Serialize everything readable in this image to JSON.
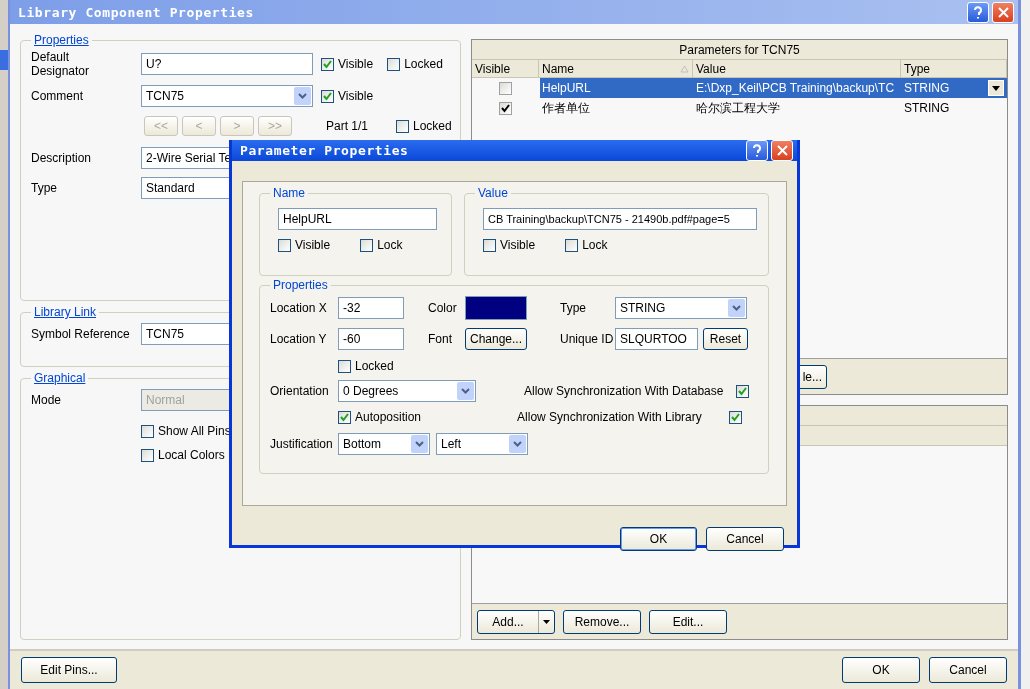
{
  "window": {
    "title": "Library Component Properties"
  },
  "properties": {
    "legend": "Properties",
    "designator": {
      "label": "Default Designator",
      "value": "U?",
      "visible": {
        "label": "Visible",
        "checked": true
      },
      "locked": {
        "label": "Locked",
        "checked": false
      }
    },
    "comment": {
      "label": "Comment",
      "value": "TCN75",
      "visible": {
        "label": "Visible",
        "checked": true
      }
    },
    "part_nav": {
      "buttons": [
        "<<",
        "<",
        ">",
        ">>"
      ],
      "disabled": true,
      "part": "Part 1/1",
      "locked": {
        "label": "Locked",
        "checked": false
      }
    },
    "description": {
      "label": "Description",
      "value": "2-Wire Serial Te"
    },
    "type": {
      "label": "Type",
      "value": "Standard"
    }
  },
  "library_link": {
    "legend": "Library Link",
    "symbol_reference": {
      "label": "Symbol Reference",
      "value": "TCN75"
    }
  },
  "graphical": {
    "legend": "Graphical",
    "mode": {
      "label": "Mode",
      "value": "Normal",
      "disabled": true
    },
    "show_all_pins": {
      "label": "Show All Pins",
      "checked": false
    },
    "local_colors": {
      "label": "Local Colors",
      "checked": false
    }
  },
  "parameters": {
    "title": "Parameters for TCN75",
    "columns": [
      "Visible",
      "Name",
      "Value",
      "Type"
    ],
    "rows": [
      {
        "visible": false,
        "name": "HelpURL",
        "value": "E:\\Dxp_Keil\\PCB Training\\backup\\TC",
        "type": "STRING",
        "selected": true
      },
      {
        "visible": true,
        "name": "作者单位",
        "value": "哈尔滨工程大学",
        "type": "STRING",
        "selected": false
      }
    ],
    "partial_button": "le..."
  },
  "models": {
    "buttons": [
      "Add...",
      "Remove...",
      "Edit..."
    ]
  },
  "footer": {
    "edit_pins": "Edit Pins...",
    "ok": "OK",
    "cancel": "Cancel"
  },
  "dialog": {
    "title": "Parameter Properties",
    "name": {
      "legend": "Name",
      "value": "HelpURL",
      "visible": {
        "label": "Visible",
        "checked": false
      },
      "lock": {
        "label": "Lock",
        "checked": false
      }
    },
    "value": {
      "legend": "Value",
      "value": "CB Training\\backup\\TCN75 - 21490b.pdf#page=5",
      "visible": {
        "label": "Visible",
        "checked": false
      },
      "lock": {
        "label": "Lock",
        "checked": false
      }
    },
    "properties": {
      "legend": "Properties",
      "location_x": {
        "label": "Location X",
        "value": "-32"
      },
      "location_y": {
        "label": "Location Y",
        "value": "-60"
      },
      "locked": {
        "label": "Locked",
        "checked": false
      },
      "color": {
        "label": "Color",
        "color": "#000080"
      },
      "font": {
        "label": "Font",
        "button": "Change..."
      },
      "type": {
        "label": "Type",
        "value": "STRING"
      },
      "unique_id": {
        "label": "Unique ID",
        "value": "SLQURTOO",
        "button": "Reset"
      },
      "orientation": {
        "label": "Orientation",
        "value": "0 Degrees"
      },
      "autoposition": {
        "label": "Autoposition",
        "checked": true
      },
      "justification": {
        "label": "Justification",
        "values": [
          "Bottom",
          "Left"
        ]
      },
      "sync_database": {
        "label": "Allow Synchronization With Database",
        "checked": true
      },
      "sync_library": {
        "label": "Allow Synchronization With Library",
        "checked": true
      }
    },
    "ok": "OK",
    "cancel": "Cancel"
  }
}
